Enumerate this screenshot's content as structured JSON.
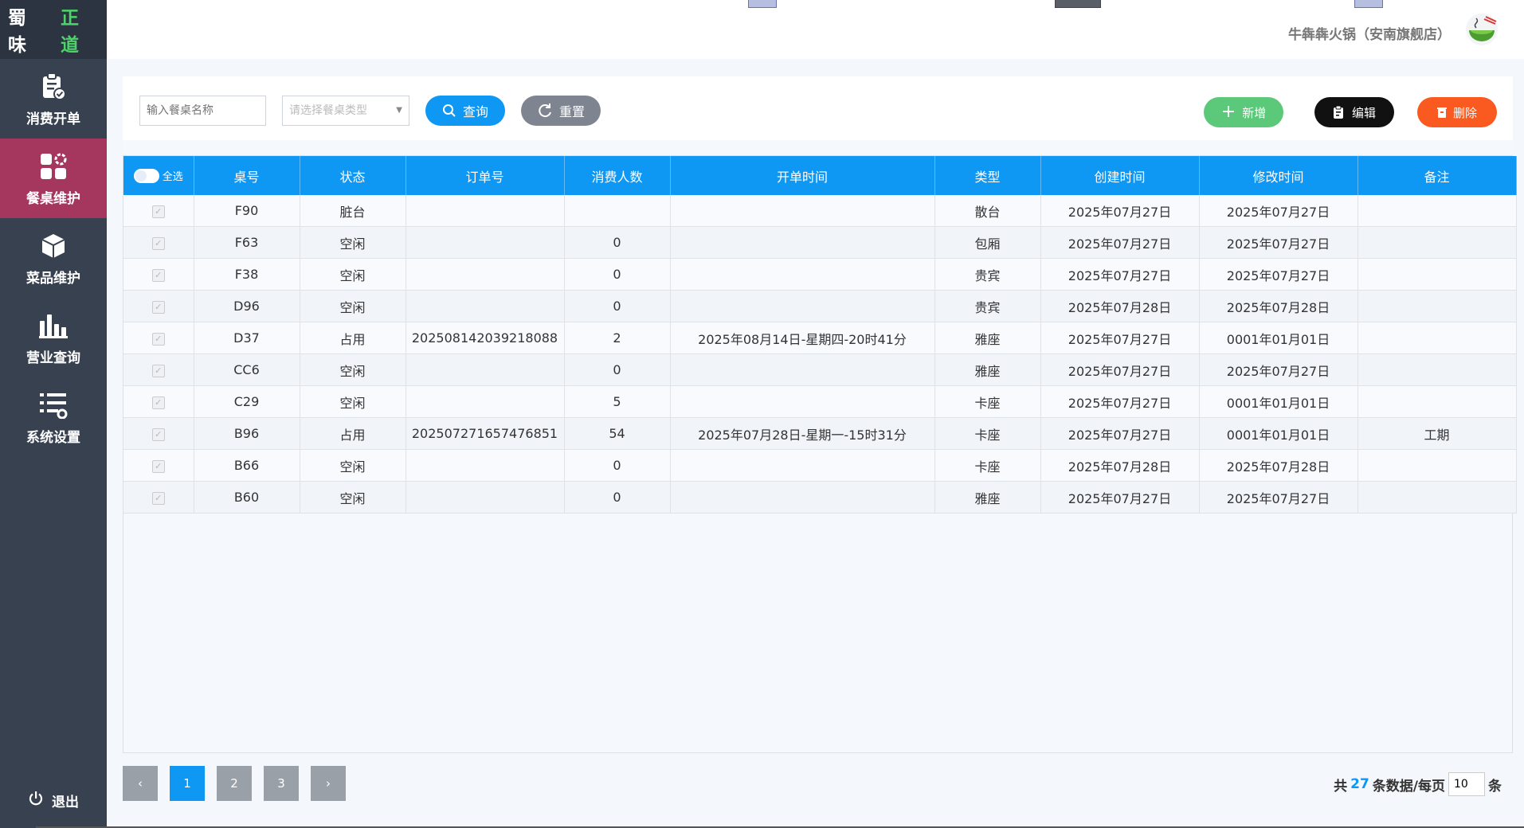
{
  "brand": {
    "part1": "蜀 味",
    "part2": "正 道"
  },
  "sidebar": {
    "items": [
      {
        "label": "消费开单",
        "icon": "clipboard-check-icon"
      },
      {
        "label": "餐桌维护",
        "icon": "grid-icon",
        "active": true
      },
      {
        "label": "菜品维护",
        "icon": "cube-icon"
      },
      {
        "label": "营业查询",
        "icon": "bar-chart-icon"
      },
      {
        "label": "系统设置",
        "icon": "list-settings-icon"
      }
    ],
    "logout": "退出"
  },
  "header": {
    "store": "牛犇犇火锅（安南旗舰店）"
  },
  "filters": {
    "name_placeholder": "输入餐桌名称",
    "type_placeholder": "请选择餐桌类型",
    "query": "查询",
    "reset": "重置"
  },
  "actions": {
    "add": "新增",
    "edit": "编辑",
    "delete": "删除"
  },
  "colors": {
    "primary": "#0f97f4",
    "add": "#5cc879",
    "edit": "#111111",
    "delete": "#fa5a1f",
    "sidebar": "#384150",
    "active": "#a5365e",
    "reset": "#7f8590"
  },
  "table": {
    "select_all": "全选",
    "columns": [
      "桌号",
      "状态",
      "订单号",
      "消费人数",
      "开单时间",
      "类型",
      "创建时间",
      "修改时间",
      "备注"
    ],
    "rows": [
      [
        "F90",
        "脏台",
        "",
        "",
        "",
        "散台",
        "2025年07月27日",
        "2025年07月27日",
        ""
      ],
      [
        "F63",
        "空闲",
        "",
        "0",
        "",
        "包厢",
        "2025年07月27日",
        "2025年07月27日",
        ""
      ],
      [
        "F38",
        "空闲",
        "",
        "0",
        "",
        "贵宾",
        "2025年07月27日",
        "2025年07月27日",
        ""
      ],
      [
        "D96",
        "空闲",
        "",
        "0",
        "",
        "贵宾",
        "2025年07月28日",
        "2025年07月28日",
        ""
      ],
      [
        "D37",
        "占用",
        "202508142039218088",
        "2",
        "2025年08月14日-星期四-20时41分",
        "雅座",
        "2025年07月27日",
        "0001年01月01日",
        ""
      ],
      [
        "CC6",
        "空闲",
        "",
        "0",
        "",
        "雅座",
        "2025年07月27日",
        "2025年07月27日",
        ""
      ],
      [
        "C29",
        "空闲",
        "",
        "5",
        "",
        "卡座",
        "2025年07月27日",
        "0001年01月01日",
        ""
      ],
      [
        "B96",
        "占用",
        "202507271657476851",
        "54",
        "2025年07月28日-星期一-15时31分",
        "卡座",
        "2025年07月27日",
        "0001年01月01日",
        "工期"
      ],
      [
        "B66",
        "空闲",
        "",
        "0",
        "",
        "卡座",
        "2025年07月28日",
        "2025年07月28日",
        ""
      ],
      [
        "B60",
        "空闲",
        "",
        "0",
        "",
        "雅座",
        "2025年07月27日",
        "2025年07月27日",
        ""
      ]
    ]
  },
  "pagination": {
    "prev": "‹",
    "next": "›",
    "pages": [
      "1",
      "2",
      "3"
    ],
    "current": "1",
    "total_prefix": "共",
    "total": "27",
    "total_suffix": "条数据/每页",
    "per_page": "10",
    "unit": "条"
  }
}
